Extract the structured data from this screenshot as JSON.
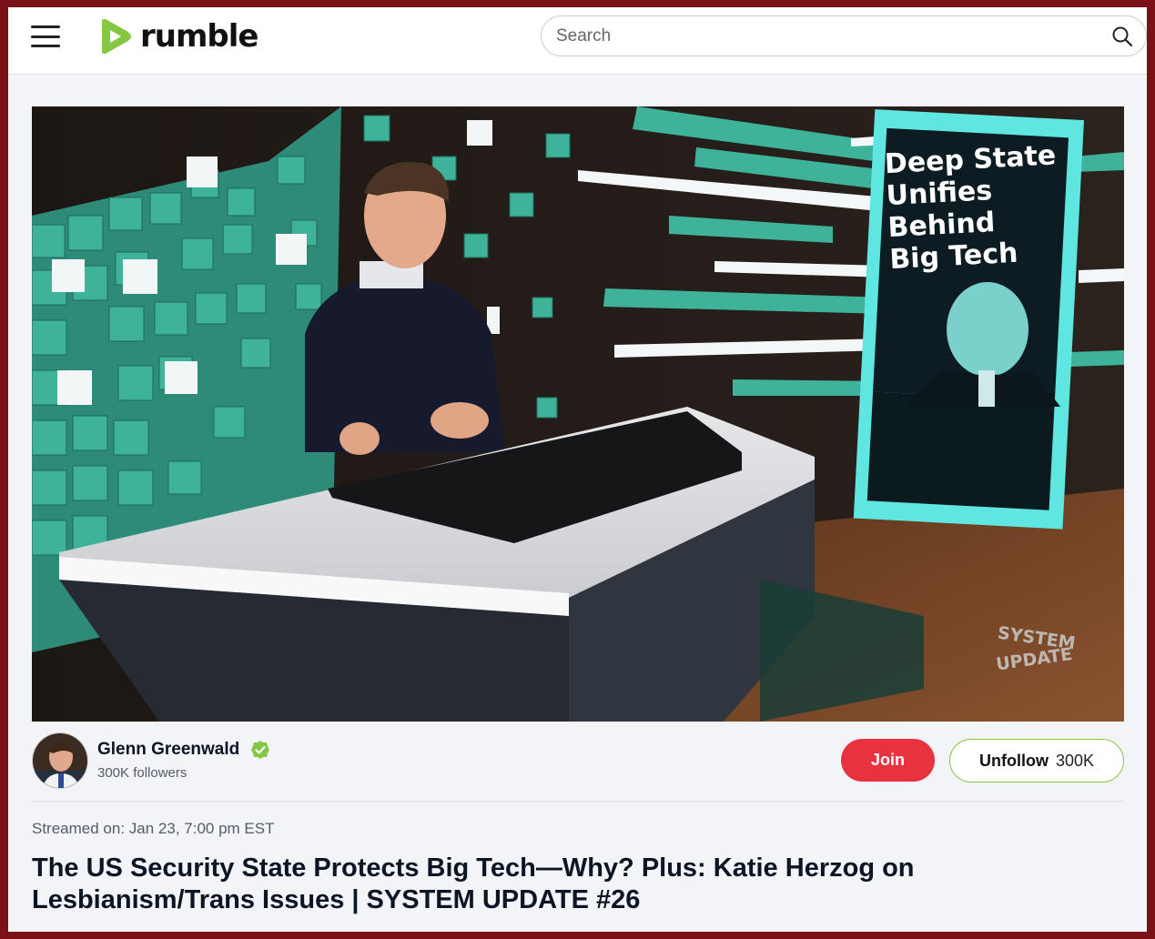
{
  "header": {
    "logo_text": "rumble",
    "search_placeholder": "Search",
    "brand_color": "#85c742"
  },
  "video": {
    "screen_headline": [
      "Deep State",
      "Unifies",
      "Behind",
      "Big Tech"
    ],
    "watermark": [
      "SYSTEM",
      "UPDATE"
    ]
  },
  "channel": {
    "name": "Glenn Greenwald",
    "verified": true,
    "followers": "300K followers",
    "join_label": "Join",
    "unfollow_label": "Unfollow",
    "unfollow_count": "300K"
  },
  "meta": {
    "streamed": "Streamed on: Jan 23, 7:00 pm EST",
    "title": "The US Security State Protects Big Tech—Why? Plus: Katie Herzog on Lesbianism/Trans Issues | SYSTEM UPDATE #26"
  },
  "colors": {
    "join": "#e8323f",
    "teal": "#3fb39a",
    "border": "#7a1116"
  }
}
